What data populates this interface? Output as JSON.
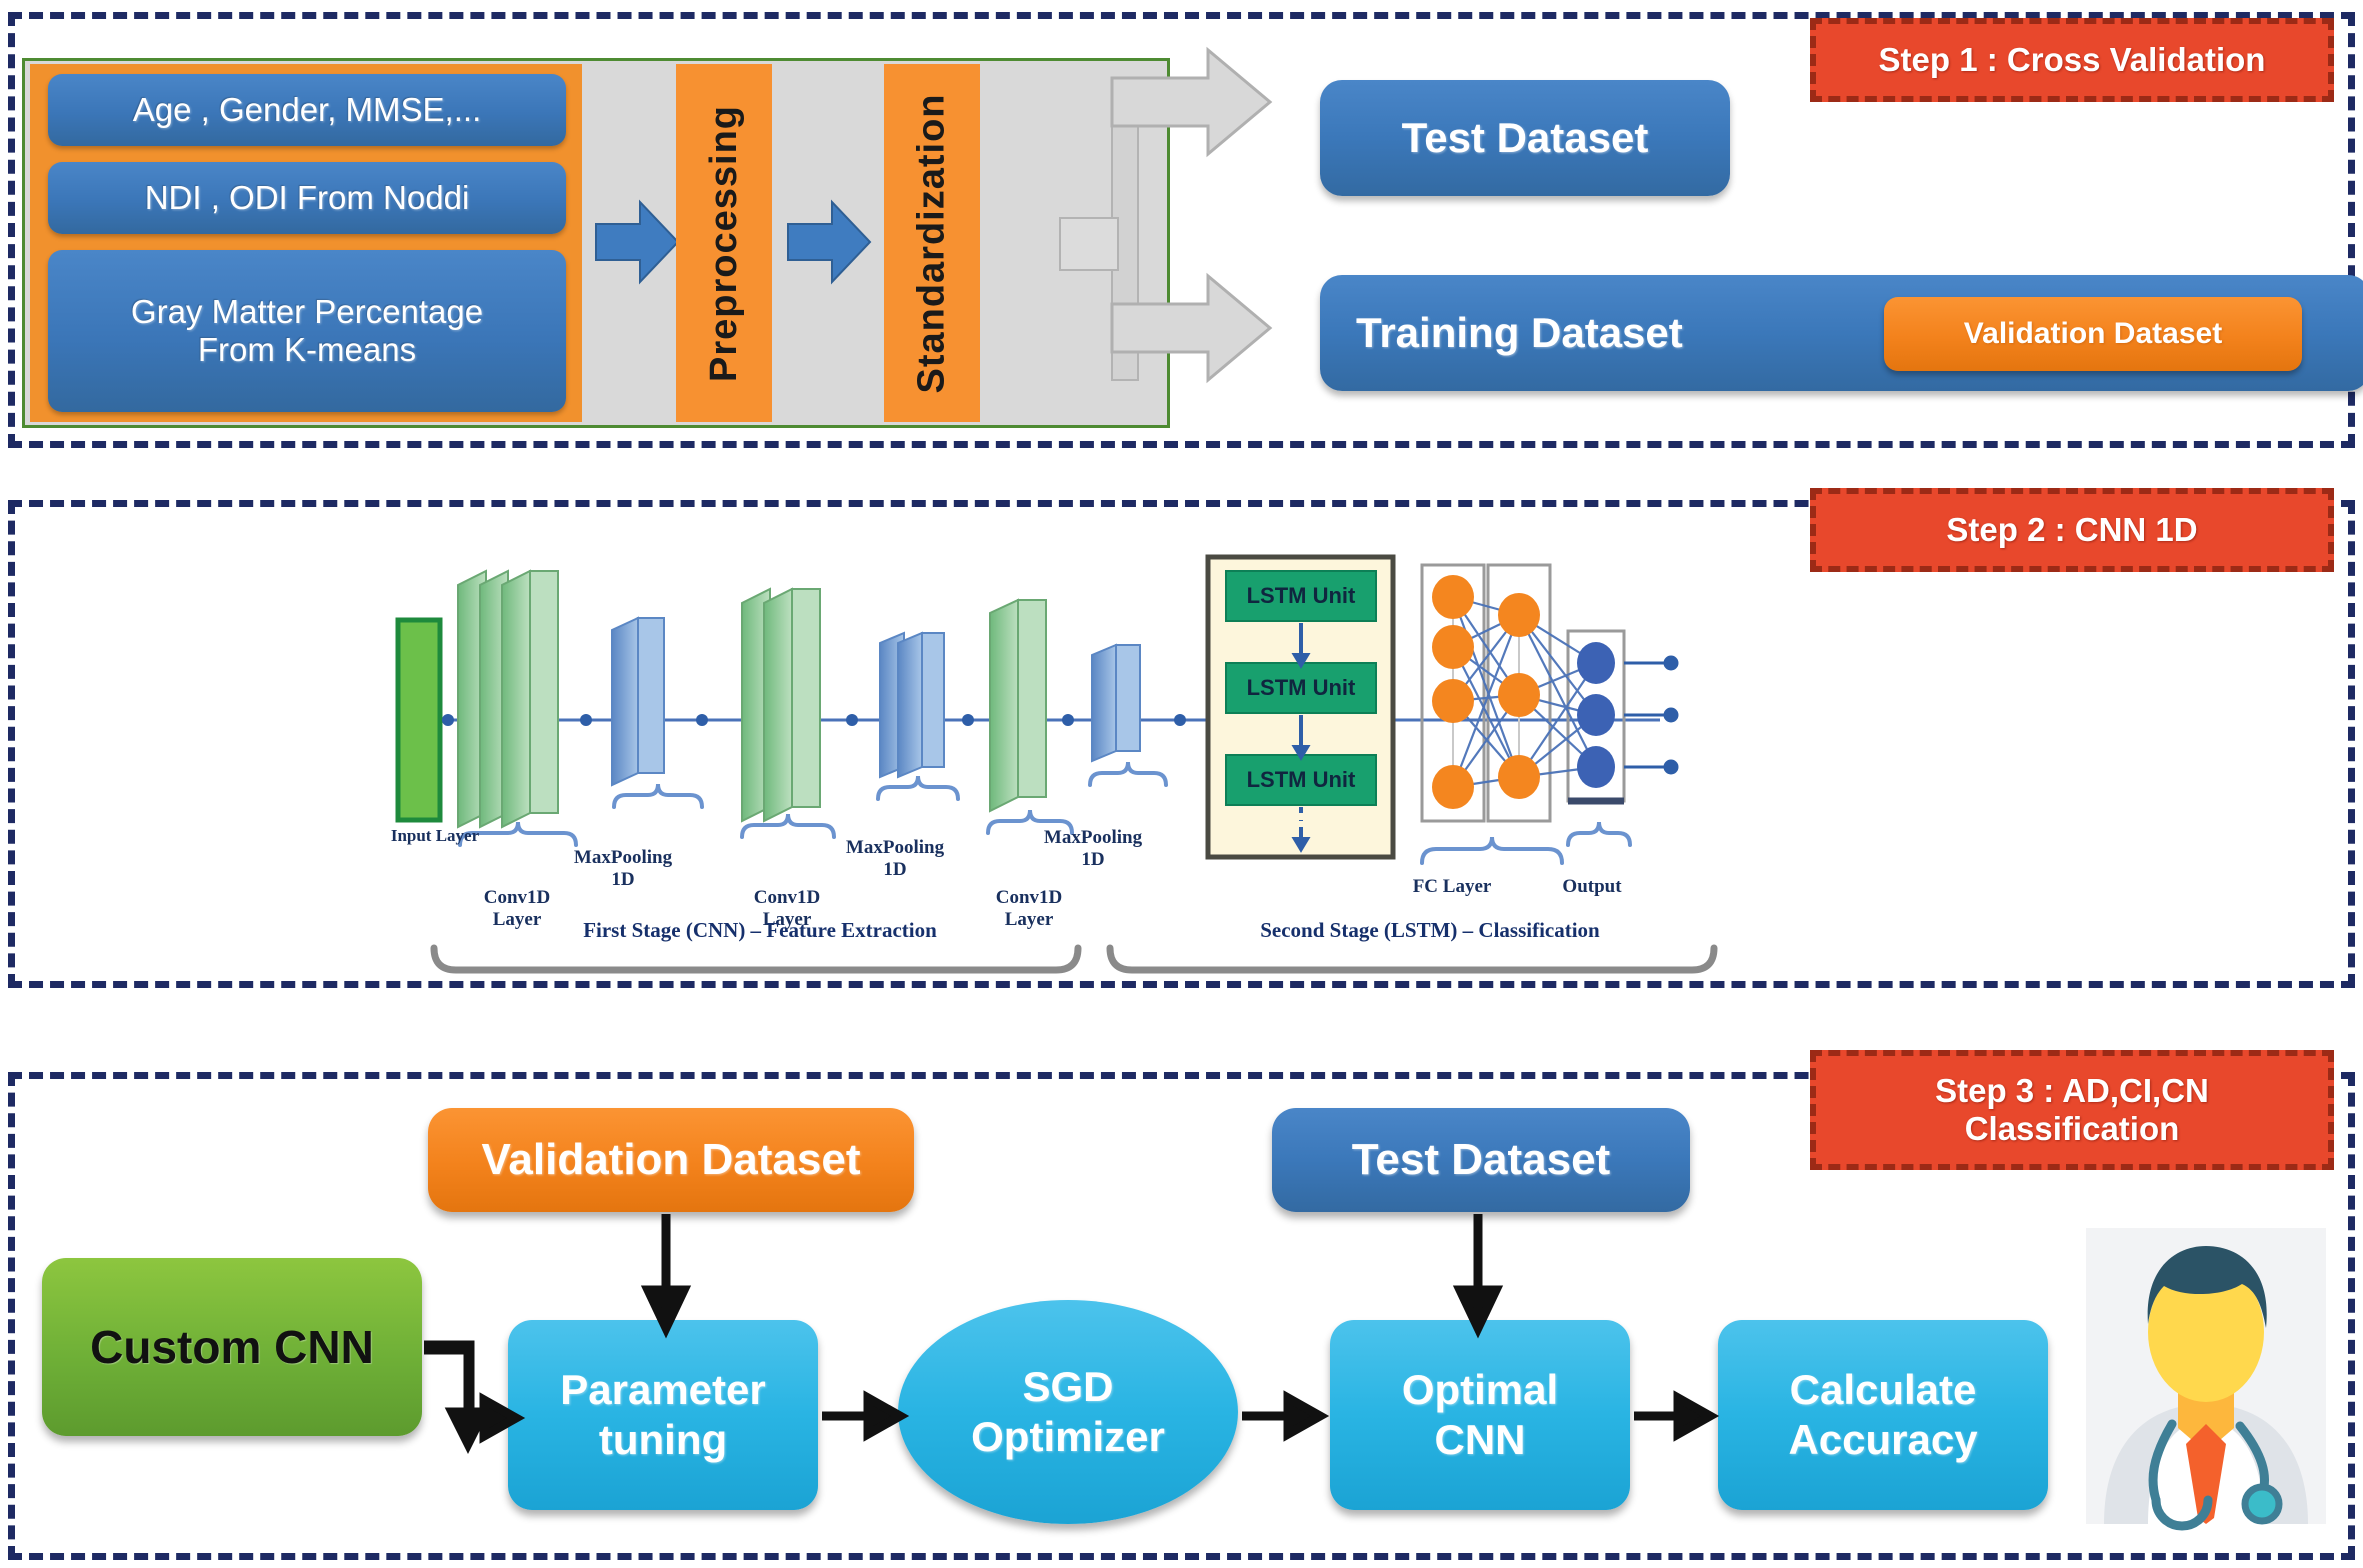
{
  "steps": [
    {
      "label": "Step 1 : Cross Validation"
    },
    {
      "label": "Step 2 : CNN 1D"
    },
    {
      "label": "Step 3 : AD,CI,CN\nClassification"
    }
  ],
  "step1": {
    "feature_boxes": [
      "Age , Gender, MMSE,...",
      "NDI , ODI From Noddi",
      "Gray Matter Percentage\nFrom K-means"
    ],
    "pipeline_stages": [
      "Preprocessing",
      "Standardization"
    ],
    "outputs": {
      "test_dataset": "Test Dataset",
      "training_dataset": "Training Dataset",
      "validation_dataset": "Validation Dataset"
    }
  },
  "step2": {
    "input_label": "Input Layer",
    "layer_labels": [
      "Conv1D\nLayer",
      "MaxPooling\n1D",
      "Conv1D\nLayer",
      "MaxPooling\n1D",
      "Conv1D\nLayer",
      "MaxPooling\n1D"
    ],
    "lstm_units": [
      "LSTM Unit",
      "LSTM Unit",
      "LSTM Unit"
    ],
    "fc_label": "FC Layer",
    "output_label": "Output",
    "stage_labels": [
      "First Stage (CNN) – Feature Extraction",
      "Second Stage (LSTM) – Classification"
    ]
  },
  "step3": {
    "validation_dataset": "Validation Dataset",
    "test_dataset": "Test Dataset",
    "custom_cnn": "Custom CNN",
    "parameter_tuning": "Parameter\ntuning",
    "sgd_optimizer": "SGD\nOptimizer",
    "optimal_cnn": "Optimal\nCNN",
    "calculate_accuracy": "Calculate\nAccuracy",
    "doctor_icon": "doctor-icon"
  },
  "colors": {
    "frame_dash": "#1e2a63",
    "chip_fill": "#e8482c",
    "chip_border": "#9c2a16",
    "blue": "#3b78ba",
    "orange": "#f3821c",
    "green": "#6fb037",
    "cyan": "#29b4e3",
    "lstm_green": "#18a06e",
    "panel_cream": "#fdf6dc",
    "gray": "#d9d9d9"
  }
}
